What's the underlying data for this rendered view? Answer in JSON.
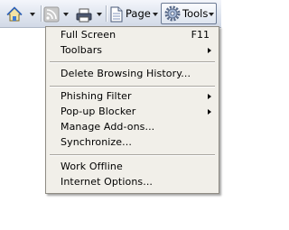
{
  "toolbar": {
    "page_label": "Page",
    "tools_label": "Tools"
  },
  "icons": [
    "home-icon",
    "feeds-icon",
    "print-icon",
    "page-icon",
    "gear-icon"
  ],
  "menu": {
    "items": [
      {
        "label": "Full Screen",
        "shortcut": "F11"
      },
      {
        "label": "Toolbars"
      },
      {
        "label": "Delete Browsing History..."
      },
      {
        "label": "Phishing Filter"
      },
      {
        "label": "Pop-up Blocker"
      },
      {
        "label": "Manage Add-ons..."
      },
      {
        "label": "Synchronize..."
      },
      {
        "label": "Work Offline"
      },
      {
        "label": "Internet Options..."
      }
    ]
  }
}
